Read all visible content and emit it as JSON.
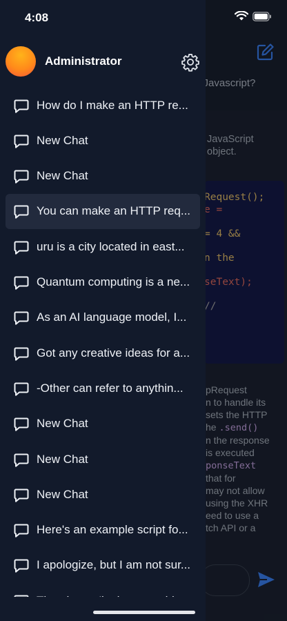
{
  "status_bar": {
    "time": "4:08"
  },
  "background_chat": {
    "question_fragment": "n Javascript?",
    "answer_lines": [
      "JavaScript",
      "object."
    ],
    "code_lines": [
      {
        "text": "Request();",
        "color": "#e8c26a"
      },
      {
        "text": "e =",
        "color": "#e26b5f"
      },
      {
        "text": "",
        "color": "#e26b5f"
      },
      {
        "text": "= 4 &&",
        "color": "#e8c26a"
      },
      {
        "text": "",
        "color": "#e8c26a"
      },
      {
        "text": "n the",
        "color": "#e8c26a"
      },
      {
        "text": "",
        "color": "#e8c26a"
      },
      {
        "text": "seText);",
        "color": "#e26b5f"
      },
      {
        "text": "",
        "color": "#e26b5f"
      },
      {
        "text": "//",
        "color": "#a7a7a7"
      }
    ],
    "explanation_lines": [
      {
        "text": "pRequest"
      },
      {
        "text": "n to handle its"
      },
      {
        "text": "sets the HTTP"
      },
      {
        "text": "he ",
        "mono": ".send()"
      },
      {
        "text": "n the response"
      },
      {
        "text": "is executed"
      },
      {
        "text": "",
        "mono": "ponseText"
      },
      {
        "text": "that for"
      },
      {
        "text": "may not allow"
      },
      {
        "text": "using the XHR"
      },
      {
        "text": "eed to use a"
      },
      {
        "text": "tch API or a"
      }
    ]
  },
  "drawer": {
    "user": {
      "name": "Administrator"
    },
    "icons": {
      "settings": "gear-icon",
      "chat": "chat-bubble-icon"
    },
    "active_index": 3,
    "chats": [
      "How do I make an HTTP re...",
      "New Chat",
      "New Chat",
      "You can make an HTTP req...",
      "uru is a city located in east...",
      "Quantum computing is a ne...",
      "As an AI language model, I...",
      "Got any creative ideas for a...",
      "-Other can refer to anythin...",
      "New Chat",
      "New Chat",
      "New Chat",
      "Here's an example script fo...",
      "I apologize, but I am not sur...",
      "The phrase 'in the something'..."
    ]
  },
  "colors": {
    "drawer_bg": "#121a2b",
    "active_row": "#222a3d",
    "accent": "#3b82f6",
    "code_bg": "#151b4a"
  }
}
